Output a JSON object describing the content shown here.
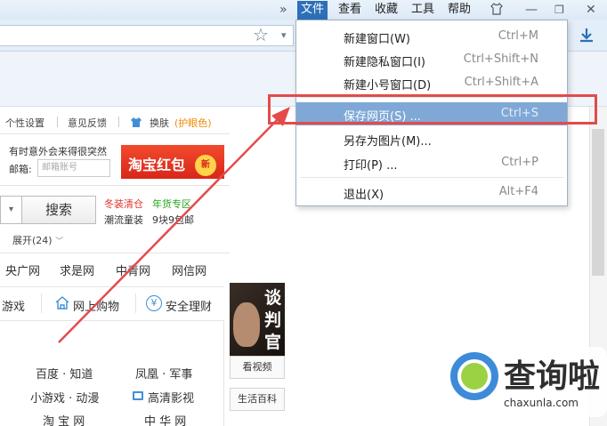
{
  "menubar": {
    "overflow": "»",
    "items": [
      "文件",
      "查看",
      "收藏",
      "工具",
      "帮助"
    ],
    "active_index": 0
  },
  "window_controls": {
    "skin_icon": "shirt-icon",
    "minimize": "—",
    "restore": "❐",
    "close": "✕"
  },
  "addressbar": {
    "favorite_icon": "☆",
    "dropdown_icon": "▾",
    "download_icon": "download-icon"
  },
  "file_menu": {
    "items": [
      {
        "label": "新建窗口(W)",
        "shortcut": "Ctrl+M"
      },
      {
        "label": "新建隐私窗口(I)",
        "shortcut": "Ctrl+Shift+N"
      },
      {
        "label": "新建小号窗口(D)",
        "shortcut": "Ctrl+Shift+A"
      },
      {
        "label": "保存网页(S) ...",
        "shortcut": "Ctrl+S",
        "highlighted": true
      },
      {
        "label": "另存为图片(M)...",
        "shortcut": ""
      },
      {
        "label": "打印(P) ...",
        "shortcut": "Ctrl+P"
      },
      {
        "label": "退出(X)",
        "shortcut": "Alt+F4"
      }
    ]
  },
  "page": {
    "top_links": {
      "personal_settings": "个性设置",
      "feedback": "意见反馈",
      "skin": "换肤",
      "eye_care": "(护眼色)"
    },
    "promo_text": "有时意外会来得很突然",
    "email_label": "邮箱:",
    "email_placeholder": "邮箱账号",
    "banner_text": "淘宝红包",
    "banner_coin": "新",
    "search_button": "搜索",
    "search_dropdown": "▾",
    "hot_links": [
      {
        "text": "冬装清仓",
        "color": "#e0312c"
      },
      {
        "text": "年货专区",
        "color": "#24a21a"
      },
      {
        "text": "潮流童装",
        "color": "#333333"
      },
      {
        "text": "9块9包邮",
        "color": "#333333"
      }
    ],
    "expand": "展开(24)",
    "site_links": [
      "央广网",
      "求是网",
      "中青网",
      "网信网"
    ],
    "categories": [
      {
        "text": "游戏"
      },
      {
        "text": "网上购物",
        "icon": "house-icon"
      },
      {
        "text": "安全理财",
        "icon": "yen-icon",
        "icon_char": "¥"
      }
    ],
    "bottom_links": [
      {
        "text": "百度 · 知道"
      },
      {
        "text": "凤凰 · 军事"
      },
      {
        "text": "小游戏 · 动漫"
      },
      {
        "text": "高清影视",
        "icon": "film-icon"
      },
      {
        "text": "淘 宝 网"
      },
      {
        "text": "中 华 网"
      }
    ],
    "poster_chars": [
      "谈",
      "判",
      "官"
    ],
    "side_buttons": [
      "看视频",
      "生活百科"
    ]
  },
  "watermark": {
    "title": "查询啦",
    "url": "chaxunla.com"
  },
  "colors": {
    "menu_active": "#2d6fb8",
    "highlight": "#7fa8d7",
    "annotation_red": "#e34b4b",
    "eye_care": "#f08a00"
  }
}
